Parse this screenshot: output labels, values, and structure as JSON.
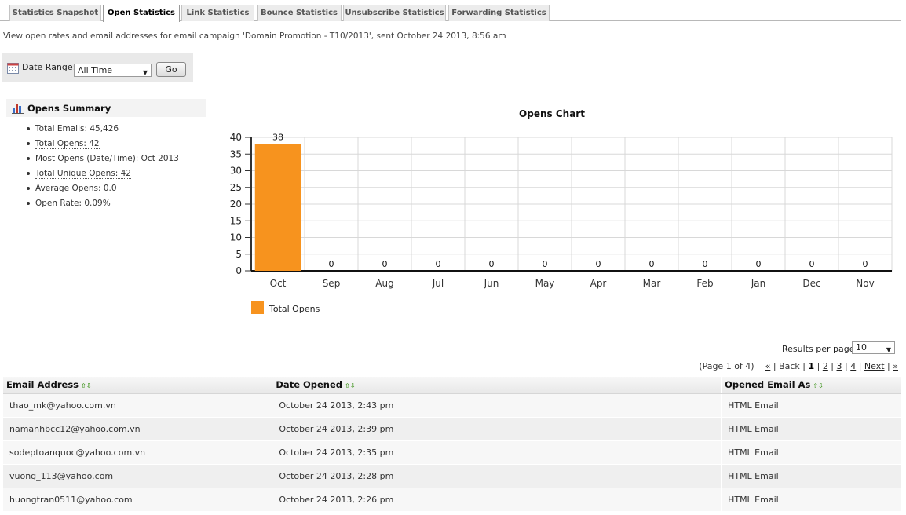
{
  "tabs": [
    {
      "label": "Statistics Snapshot",
      "active": false
    },
    {
      "label": "Open Statistics",
      "active": true
    },
    {
      "label": "Link Statistics",
      "active": false
    },
    {
      "label": "Bounce Statistics",
      "active": false
    },
    {
      "label": "Unsubscribe Statistics",
      "active": false
    },
    {
      "label": "Forwarding Statistics",
      "active": false
    }
  ],
  "intro": "View open rates and email addresses for email campaign 'Domain Promotion - T10/2013', sent October 24 2013, 8:56 am",
  "date_range": {
    "label": "Date Range:",
    "selected": "All Time",
    "go_label": "Go"
  },
  "summary": {
    "title": "Opens Summary",
    "items": [
      {
        "label": "Total Emails: 45,426",
        "link": false
      },
      {
        "label": "Total Opens: 42",
        "link": true
      },
      {
        "label": "Most Opens (Date/Time): Oct 2013",
        "link": false
      },
      {
        "label": "Total Unique Opens: 42",
        "link": true
      },
      {
        "label": "Average Opens: 0.0",
        "link": false
      },
      {
        "label": "Open Rate: 0.09%",
        "link": false
      }
    ]
  },
  "chart_data": {
    "type": "bar",
    "title": "Opens Chart",
    "categories": [
      "Oct",
      "Sep",
      "Aug",
      "Jul",
      "Jun",
      "May",
      "Apr",
      "Mar",
      "Feb",
      "Jan",
      "Dec",
      "Nov"
    ],
    "series": [
      {
        "name": "Total Opens",
        "values": [
          38,
          0,
          0,
          0,
          0,
          0,
          0,
          0,
          0,
          0,
          0,
          0
        ],
        "color": "#f7931e"
      }
    ],
    "ylim": [
      0,
      40
    ],
    "yticks": [
      0,
      5,
      10,
      15,
      20,
      25,
      30,
      35,
      40
    ],
    "grid": true,
    "legend": "bottom-left"
  },
  "results": {
    "per_page_label": "Results per page:",
    "per_page_value": "10",
    "page_info": "(Page 1 of 4)",
    "first": "«",
    "back": "Back",
    "current": "1",
    "pages": [
      "2",
      "3",
      "4"
    ],
    "next": "Next",
    "last": "»"
  },
  "table": {
    "headers": [
      "Email Address",
      "Date Opened",
      "Opened Email As"
    ],
    "rows": [
      [
        "thao_mk@yahoo.com.vn",
        "October 24 2013, 2:43 pm",
        "HTML Email"
      ],
      [
        "namanhbcc12@yahoo.com.vn",
        "October 24 2013, 2:39 pm",
        "HTML Email"
      ],
      [
        "sodeptoanquoc@yahoo.com.vn",
        "October 24 2013, 2:35 pm",
        "HTML Email"
      ],
      [
        "vuong_113@yahoo.com",
        "October 24 2013, 2:28 pm",
        "HTML Email"
      ],
      [
        "huongtran0511@yahoo.com",
        "October 24 2013, 2:26 pm",
        "HTML Email"
      ]
    ]
  }
}
